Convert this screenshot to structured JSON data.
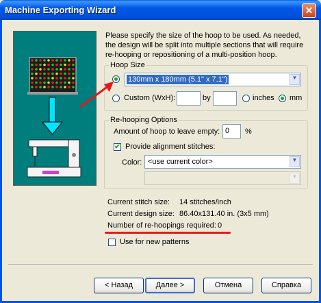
{
  "window": {
    "title": "Machine Exporting Wizard",
    "close_glyph": "✕"
  },
  "instructions": "Please specify the size of the hoop to be used.  As needed, the design will be split into multiple sections that will require re-hooping or repositioning of a multi-position hoop.",
  "hoop_size": {
    "legend": "Hoop Size",
    "preset_value": "130mm x 180mm (5.1\" x 7.1\")",
    "preset_selected": true,
    "custom_label": "Custom (WxH):",
    "custom_width": "",
    "by_label": "by",
    "custom_height": "",
    "inches_label": "inches",
    "mm_label": "mm",
    "unit_selected": "mm"
  },
  "rehooping": {
    "legend": "Re-hooping Options",
    "amount_label": "Amount of hoop to leave empty:",
    "amount_value": "0",
    "percent_label": "%",
    "alignment_label": "Provide alignment stitches:",
    "alignment_checked": true,
    "color_label": "Color:",
    "color_value": "<use current color>",
    "second_value": ""
  },
  "info": {
    "stitch_size_label": "Current stitch size:",
    "stitch_size_value": "14 stitches/inch",
    "design_size_label": "Current design size:",
    "design_size_value": "86.40x131.40 in.  (3x5 mm)",
    "rehoopings_label": "Number of re-hoopings required:",
    "rehoopings_value": "0"
  },
  "use_for_new": {
    "label": "Use for new patterns",
    "checked": false
  },
  "buttons": {
    "back": "< Назад",
    "next": "Далее >",
    "cancel": "Отмена",
    "help": "Справка"
  },
  "colors": {
    "accent_red": "#E31B1B",
    "panel_teal": "#007D7D",
    "title_blue": "#0058E6"
  },
  "icons": [
    "hoop-grid-icon",
    "down-arrow-icon",
    "sewing-machine-icon"
  ]
}
